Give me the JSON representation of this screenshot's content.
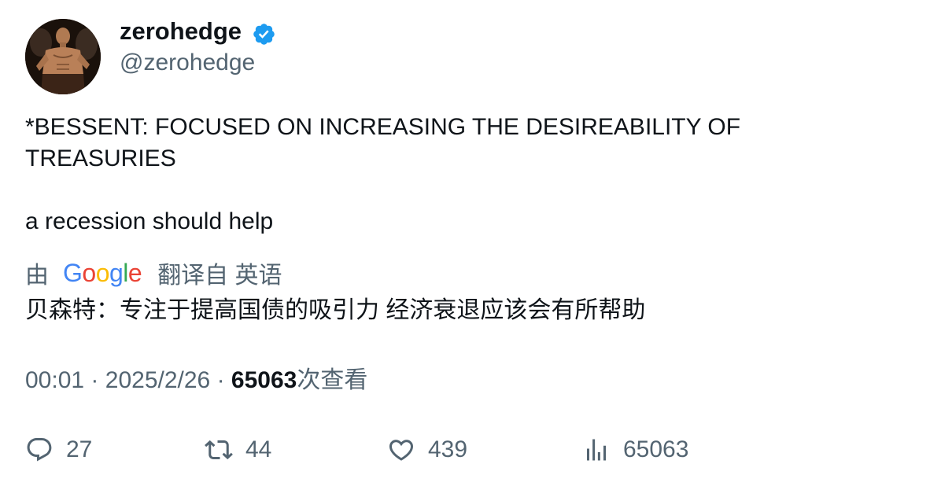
{
  "author": {
    "display_name": "zerohedge",
    "handle": "@zerohedge",
    "verified_color": "#1d9bf0"
  },
  "tweet": {
    "line1": "*BESSENT: FOCUSED ON INCREASING THE DESIREABILITY OF TREASURIES",
    "line2": "a recession should help"
  },
  "translation": {
    "prefix": "由",
    "provider": "Google",
    "suffix": "翻译自 英语",
    "text": "贝森特：专注于提高国债的吸引力 经济衰退应该会有所帮助"
  },
  "meta": {
    "time": "00:01",
    "separator": "·",
    "date": "2025/2/26",
    "views": "65063",
    "views_label": "次查看"
  },
  "actions": {
    "replies": "27",
    "retweets": "44",
    "likes": "439",
    "views": "65063"
  },
  "colors": {
    "text": "#0f1419",
    "secondary": "#536471"
  }
}
